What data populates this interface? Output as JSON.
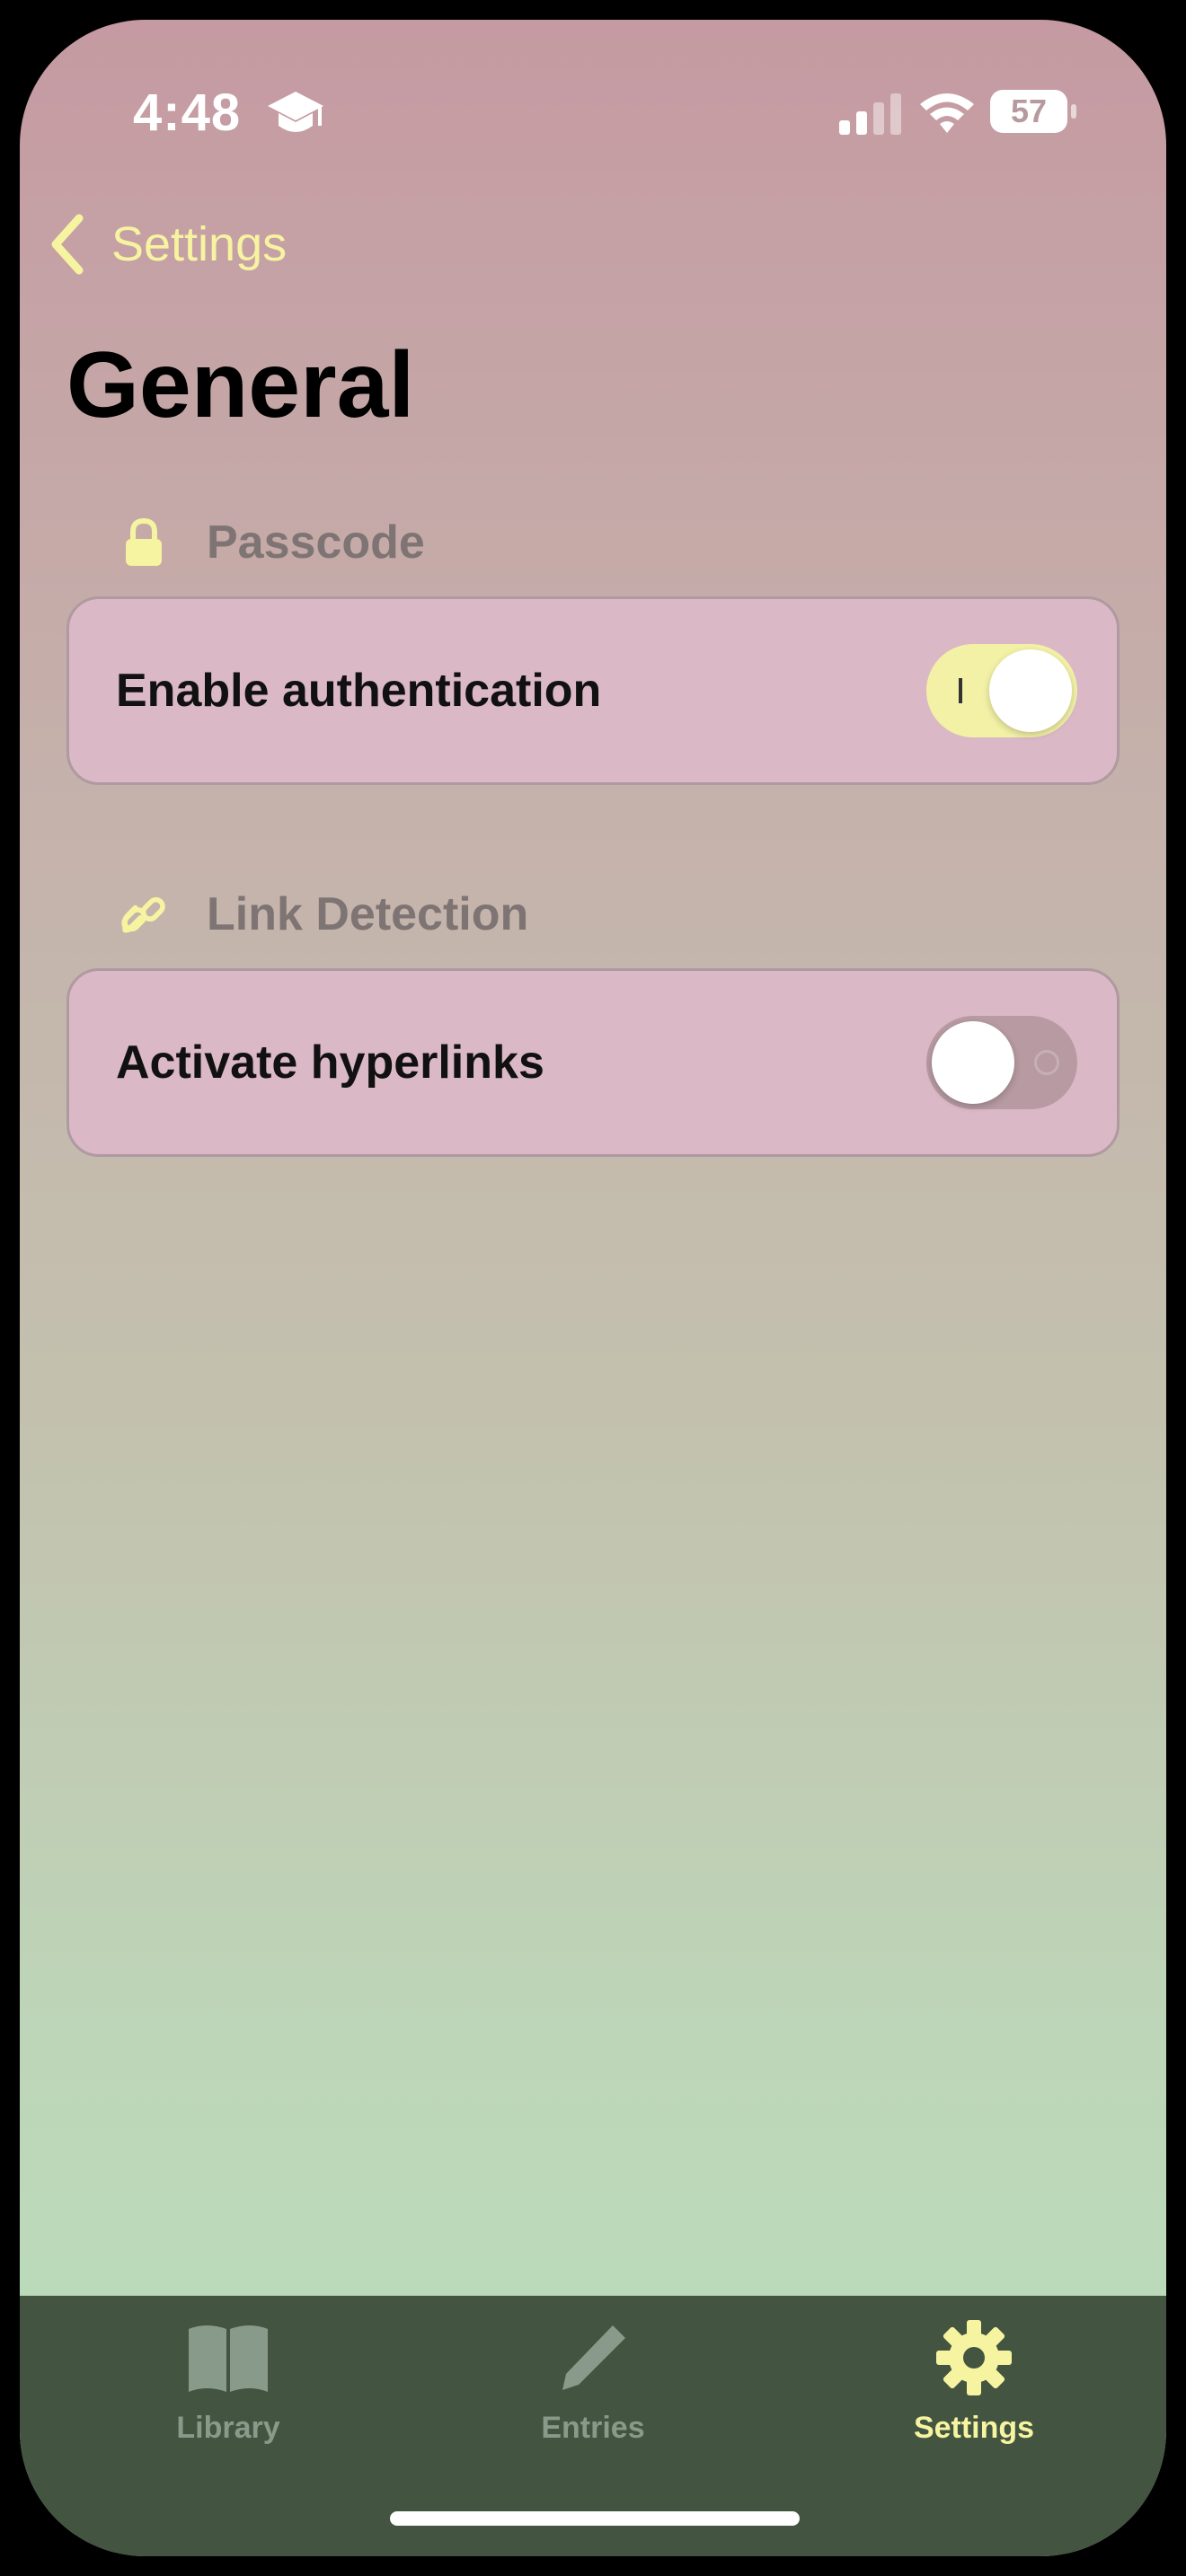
{
  "status": {
    "time": "4:48",
    "battery": "57"
  },
  "nav": {
    "back_label": "Settings"
  },
  "page": {
    "title": "General"
  },
  "sections": [
    {
      "header": "Passcode",
      "icon": "lock-icon",
      "row_label": "Enable authentication",
      "toggle_on": true
    },
    {
      "header": "Link Detection",
      "icon": "link-icon",
      "row_label": "Activate hyperlinks",
      "toggle_on": false
    }
  ],
  "tabs": [
    {
      "label": "Library",
      "icon": "book-icon",
      "active": false
    },
    {
      "label": "Entries",
      "icon": "pencil-icon",
      "active": false
    },
    {
      "label": "Settings",
      "icon": "gear-icon",
      "active": true
    }
  ],
  "colors": {
    "accent": "#f6f3a1",
    "tab_bar": "#435440",
    "card": "#dbb8c6"
  }
}
